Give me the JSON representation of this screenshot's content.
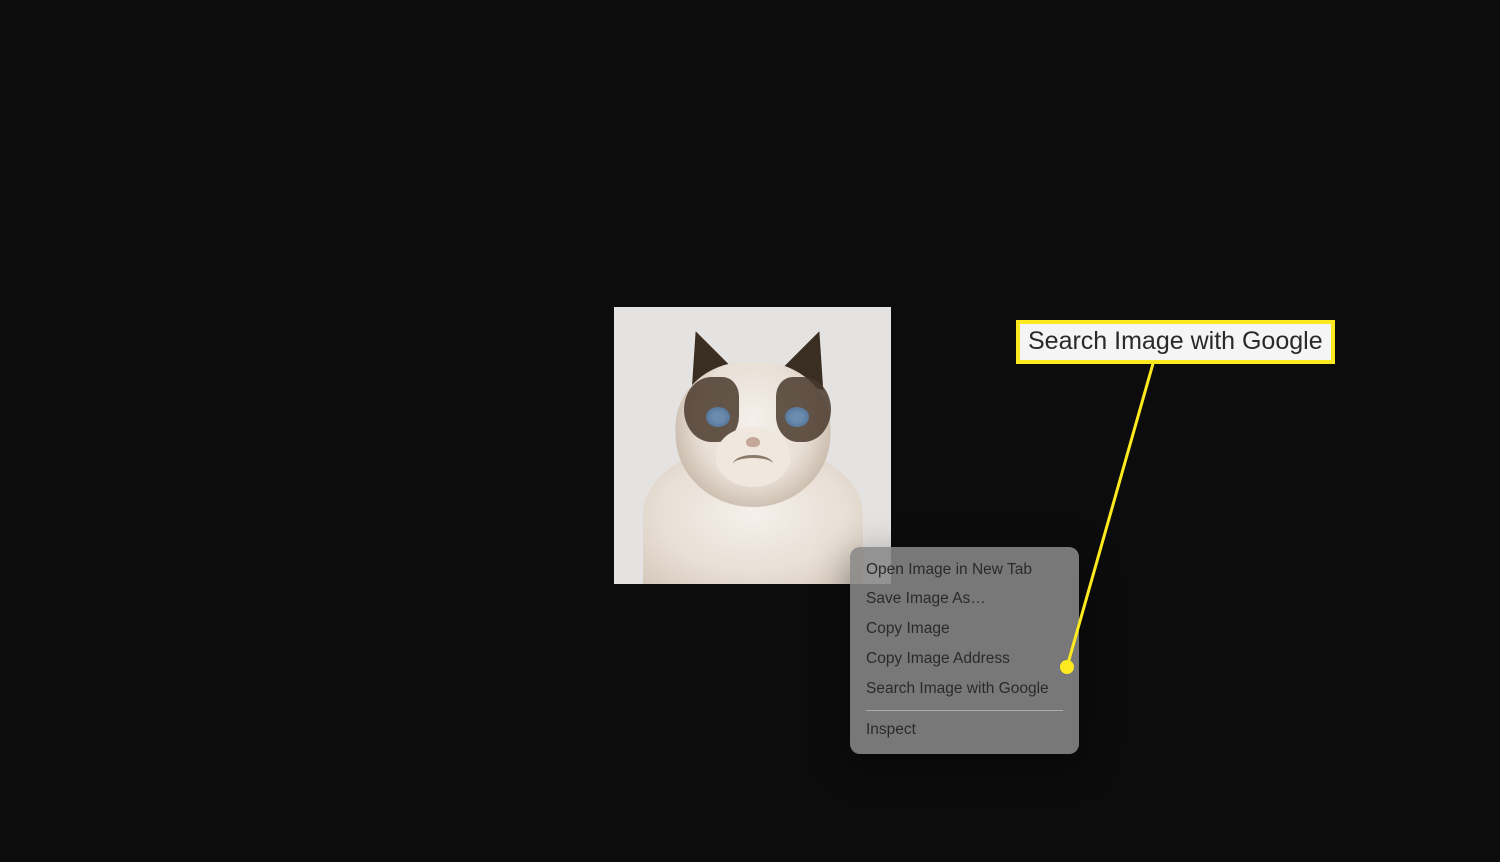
{
  "image": {
    "alt": "Grumpy Cat"
  },
  "contextMenu": {
    "items": [
      "Open Image in New Tab",
      "Save Image As…",
      "Copy Image",
      "Copy Image Address",
      "Search Image with Google"
    ],
    "afterDivider": "Inspect"
  },
  "callout": {
    "label": "Search Image with Google"
  }
}
